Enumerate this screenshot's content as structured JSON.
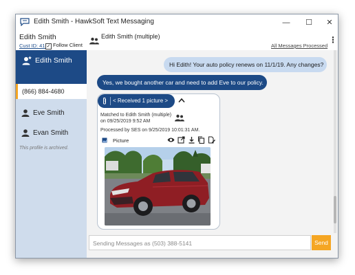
{
  "window": {
    "title": "Edith Smith - HawkSoft Text Messaging",
    "controls": {
      "minimize": "—",
      "maximize": "☐",
      "close": "✕"
    }
  },
  "sidebar": {
    "client_name": "Edith Smith",
    "cust_id": "Cust ID: 416",
    "follow_label": "Follow Client",
    "follow_checked": true,
    "active_contact": {
      "name": "Edith Smith",
      "phone": "(866) 884-4680"
    },
    "contacts": [
      {
        "name": "Eve Smith"
      },
      {
        "name": "Evan Smith"
      }
    ],
    "archived_note": "This profile is archived."
  },
  "conversation": {
    "title": "Edith Smith (multiple)",
    "processed_link": "All Messages Processed",
    "messages": {
      "sent": "Hi Edith! Your auto policy renews on 11/1/19. Any changes?",
      "received": "Yes, we bought another car and need to add Eve to our policy."
    },
    "attachment": {
      "pill_label": "< Received 1 picture >",
      "matched_line1": "Matched to Edith Smith (multiple)",
      "matched_line2": "on 09/25/2019 9:52 AM",
      "processed_line": "Processed by SES on 9/25/2019 10:01:31 AM.",
      "item_label": "Picture"
    }
  },
  "composer": {
    "placeholder": "Sending Messages as (503) 388-5141",
    "send_label": "Send"
  },
  "colors": {
    "brand_blue": "#1d4a86",
    "sidebar_bg": "#cfdcec",
    "accent_orange": "#f5a623",
    "sent_bubble": "#c8daf0"
  }
}
